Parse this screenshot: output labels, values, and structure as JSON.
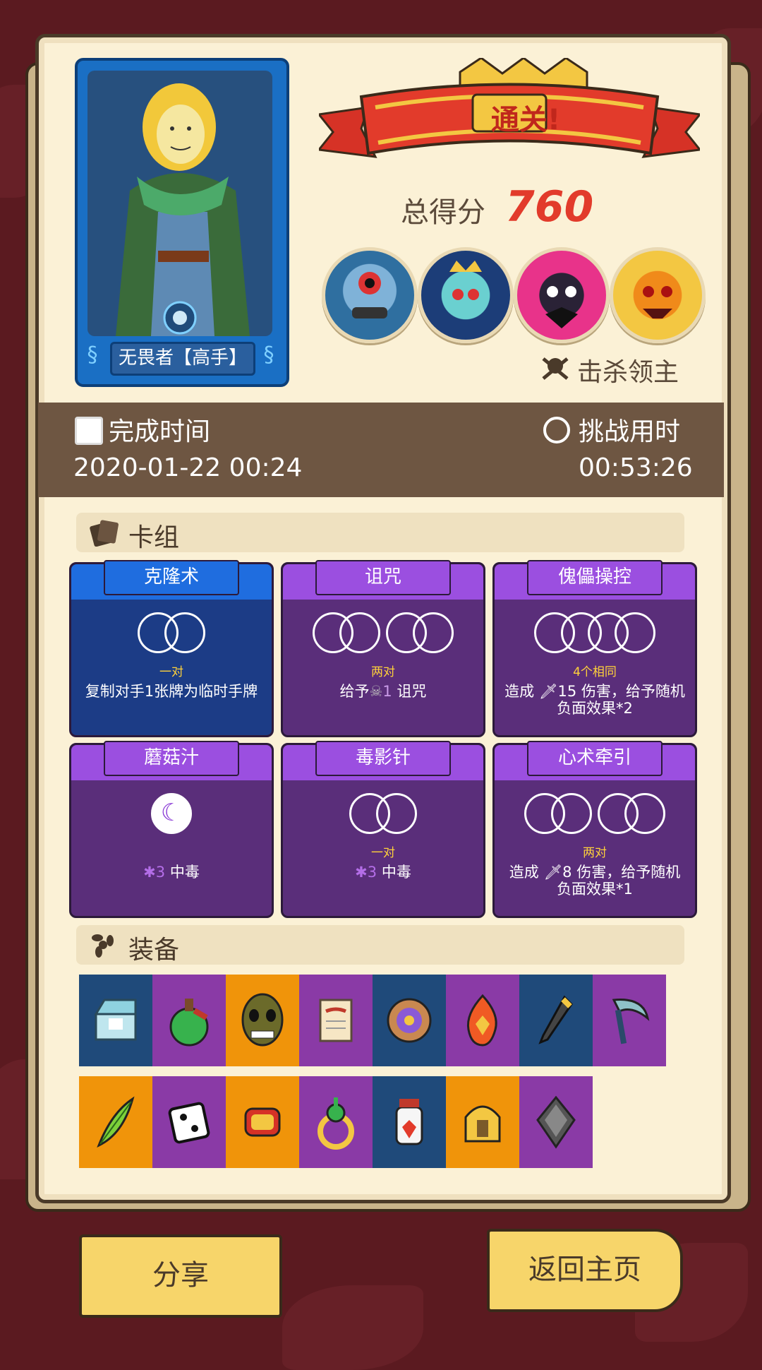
{
  "hero": {
    "name": "无畏者【高手】"
  },
  "result": {
    "title": "通关!",
    "score_label": "总得分",
    "score": "760"
  },
  "bosses": [
    "blue-ogre-boss",
    "spider-king-boss",
    "pink-demon-boss",
    "pumpkin-sun-boss"
  ],
  "kill_label": "击杀领主",
  "times": {
    "finish_label": "完成时间",
    "finish_value": "2020-01-22 00:24",
    "challenge_label": "挑战用时",
    "challenge_value": "00:53:26"
  },
  "deck": {
    "title": "卡组",
    "cards": [
      {
        "name": "克隆术",
        "count": "一对",
        "desc": "复制对手1张牌为临时手牌"
      },
      {
        "name": "诅咒",
        "count": "两对",
        "desc_pre": "给予",
        "desc_num": "1",
        "desc_post": " 诅咒"
      },
      {
        "name": "傀儡操控",
        "count": "4个相同",
        "desc_pre": "造成 ",
        "desc_num": "15",
        "desc_post": " 伤害，给予随机负面效果*2"
      },
      {
        "name": "蘑菇汁",
        "count": "",
        "desc_pre": "",
        "desc_num": "3",
        "desc_post": " 中毒"
      },
      {
        "name": "毒影针",
        "count": "一对",
        "desc_pre": "",
        "desc_num": "3",
        "desc_post": " 中毒"
      },
      {
        "name": "心术牵引",
        "count": "两对",
        "desc_pre": "造成 ",
        "desc_num": "8",
        "desc_post": " 伤害，给予随机负面效果*1"
      }
    ]
  },
  "equipment": {
    "title": "装备",
    "row1": [
      "chest-icon",
      "potion-icon",
      "mask-icon",
      "scroll-icon",
      "shield-icon",
      "flame-gem-icon",
      "dagger-icon",
      "scythe-icon"
    ],
    "row2": [
      "feather-icon",
      "dice-icon",
      "gauntlet-icon",
      "ring-icon",
      "jar-icon",
      "helmet-icon",
      "crystal-icon"
    ]
  },
  "buttons": {
    "share": "分享",
    "home": "返回主页"
  },
  "colors": {
    "blue_card": "#1c3c86",
    "purple_card": "#5a2e7a",
    "accent_red": "#e23b2b",
    "eq_blue": "#1f4a7a",
    "eq_purple": "#8a3aa6",
    "eq_orange": "#f0940a"
  }
}
